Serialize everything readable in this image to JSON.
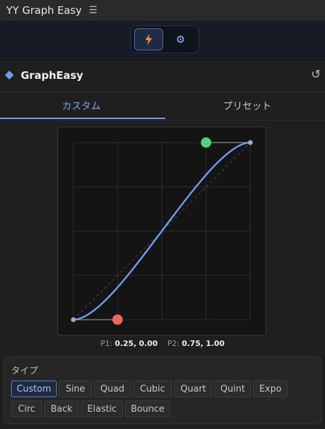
{
  "app": {
    "title": "YY Graph Easy",
    "menu_icon": "hamburger-icon"
  },
  "toolbar": {
    "modes": [
      {
        "name": "lightning",
        "icon": "lightning-icon",
        "active": true
      },
      {
        "name": "settings",
        "icon": "gear-icon",
        "active": false
      }
    ]
  },
  "panel": {
    "title": "GraphEasy",
    "refresh_icon": "refresh-icon"
  },
  "tabs": [
    {
      "label": "カスタム",
      "active": true
    },
    {
      "label": "プリセット",
      "active": false
    }
  ],
  "curve": {
    "p1": {
      "label": "P1:",
      "x": "0.25",
      "y": "0.00"
    },
    "p2": {
      "label": "P2:",
      "x": "0.75",
      "y": "1.00"
    },
    "colors": {
      "curve": "#6e9bf3",
      "p1_handle": "#f06464",
      "p2_handle": "#5ccf7a",
      "grid": "#2e2e2e"
    }
  },
  "types": {
    "label": "タイプ",
    "selected": "Custom",
    "options": [
      "Custom",
      "Sine",
      "Quad",
      "Cubic",
      "Quart",
      "Quint",
      "Expo",
      "Circ",
      "Back",
      "Elastic",
      "Bounce"
    ]
  }
}
